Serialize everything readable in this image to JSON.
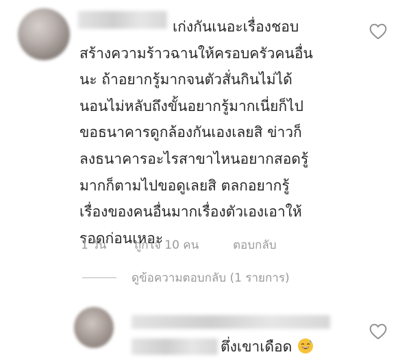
{
  "comment": {
    "text_lines": [
      "เก่งกันเนอะเรื่องชอบ",
      "สร้างความร้าวฉานให้ครอบครัวคนอื่น",
      "นะ ถ้าอยากรู้มากจนตัวสั่นกินไม่ได้",
      "นอนไม่หลับถึงขั้นอยากรู้มากเนี่ยก็ไป",
      "ขอธนาคารดูกล้องกันเองเลยสิ ข่าวก็",
      "ลงธนาคารอะไรสาขาไหนอยากสอดรู้",
      "มากก็ตามไปขอดูเลยสิ ตลกอยากรู้",
      "เรื่องของคนอื่นมากเรื่องตัวเองเอาให้",
      "รอดก่อนเหอะ"
    ],
    "time": "1 วัน",
    "likes": "ถูกใจ 10 คน",
    "reply_label": "ตอบกลับ",
    "view_replies": "ดูข้อความตอบกลับ (1 รายการ)"
  },
  "reply": {
    "text": "ตึ่งเขาเดือด"
  },
  "icons": {
    "like": "heart-outline-icon",
    "emoji": "sweat-smile-emoji"
  },
  "colors": {
    "text": "#262626",
    "meta": "#999999"
  }
}
